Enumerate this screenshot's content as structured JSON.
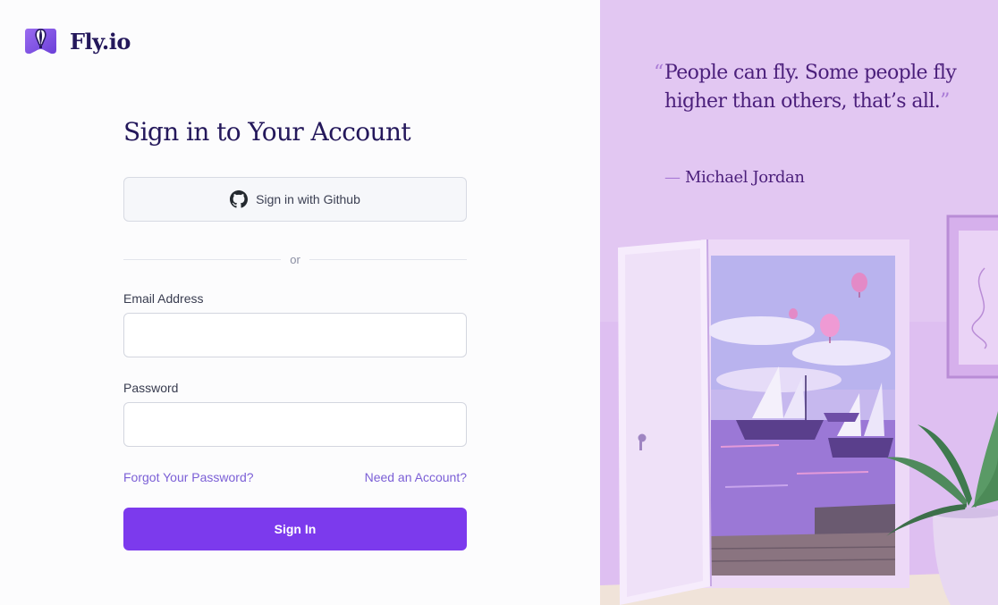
{
  "brand": {
    "name": "Fly.io"
  },
  "form": {
    "title": "Sign in to Your Account",
    "github_label": "Sign in with Github",
    "divider_text": "or",
    "email_label": "Email Address",
    "email_value": "",
    "password_label": "Password",
    "password_value": "",
    "forgot_link": "Forgot Your Password?",
    "need_account_link": "Need an Account?",
    "submit_label": "Sign In"
  },
  "quote": {
    "open_mark": "“",
    "text": "People can fly. Some people fly higher than others, that’s all.",
    "close_mark": "”",
    "dash": "—",
    "author": "Michael Jordan"
  },
  "icons": {
    "logo": "balloon-logo-icon",
    "github": "github-icon"
  },
  "colors": {
    "primary": "#7c3aed",
    "title": "#24185b",
    "link": "#7b5fd6",
    "panel_bg": "#e2c7f2"
  }
}
